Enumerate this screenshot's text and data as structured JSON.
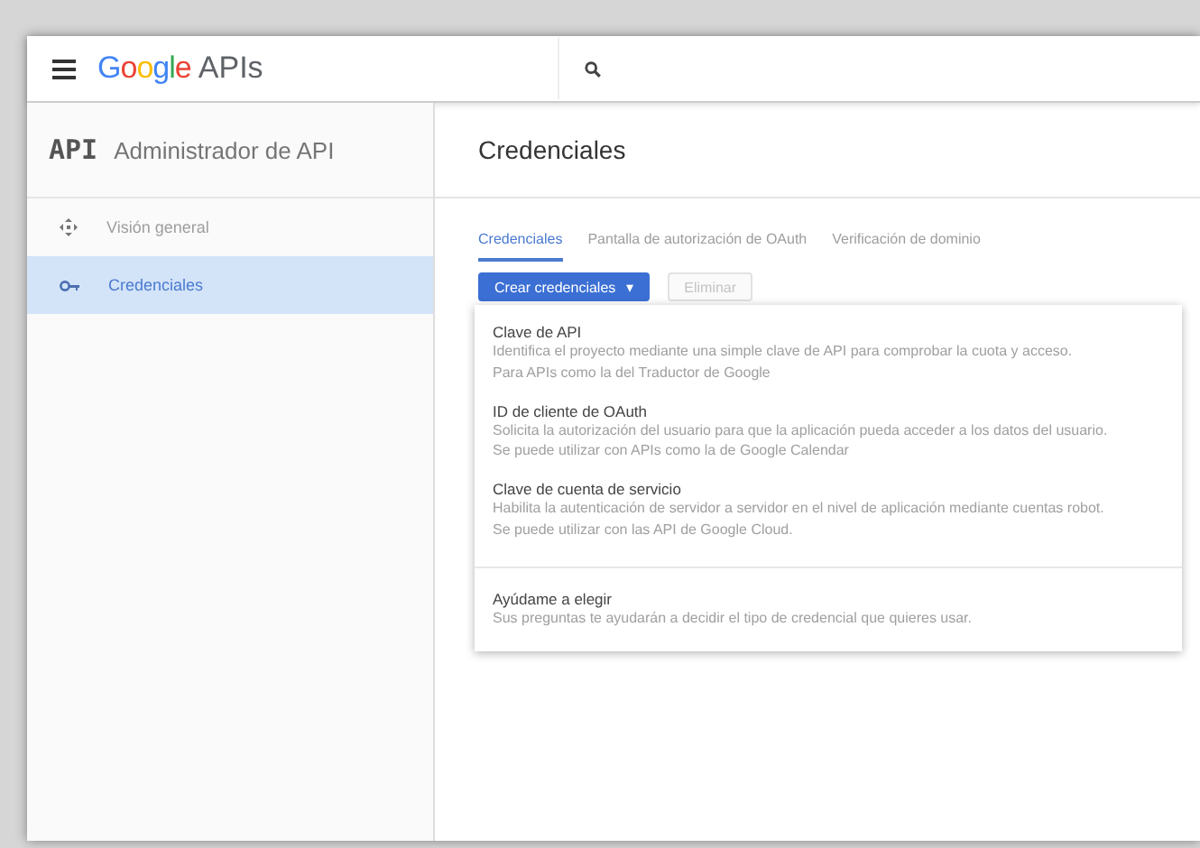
{
  "header": {
    "logo": "Google",
    "product": "APIs"
  },
  "sidebar": {
    "icon_text": "API",
    "title": "Administrador de API",
    "items": [
      {
        "kind": "overview",
        "label": "Visión general",
        "selected": false
      },
      {
        "kind": "key",
        "label": "Credenciales",
        "selected": true
      }
    ]
  },
  "page_title": "Credenciales",
  "tabs": [
    {
      "label": "Credenciales",
      "selected": true
    },
    {
      "label": "Pantalla de autorización de OAuth",
      "selected": false
    },
    {
      "label": "Verificación de dominio",
      "selected": false
    }
  ],
  "buttons": [
    {
      "label": "Crear credenciales",
      "caret": "▾",
      "disabled": false
    },
    {
      "label": "Eliminar",
      "disabled": true
    }
  ],
  "menu": [
    {
      "title": "Clave de API",
      "lines": [
        "Identifica el proyecto mediante una simple clave de API para comprobar la cuota y acceso.",
        "Para APIs como la del Traductor de Google"
      ],
      "divider": false
    },
    {
      "title": "ID de cliente de OAuth",
      "lines": [
        "Solicita la autorización del usuario para que la aplicación pueda acceder a los datos del usuario.",
        "Se puede utilizar con APIs como la de Google Calendar"
      ],
      "divider": false
    },
    {
      "title": "Clave de cuenta de servicio",
      "lines": [
        "Habilita la autenticación de servidor a servidor en el nivel de aplicación mediante cuentas robot.",
        "Se puede utilizar con las API de Google Cloud."
      ],
      "divider": false
    },
    {
      "title": "Ayúdame a elegir",
      "lines": [
        "Sus preguntas te ayudarán a decidir el tipo de credencial que quieres usar."
      ],
      "divider": true
    }
  ]
}
